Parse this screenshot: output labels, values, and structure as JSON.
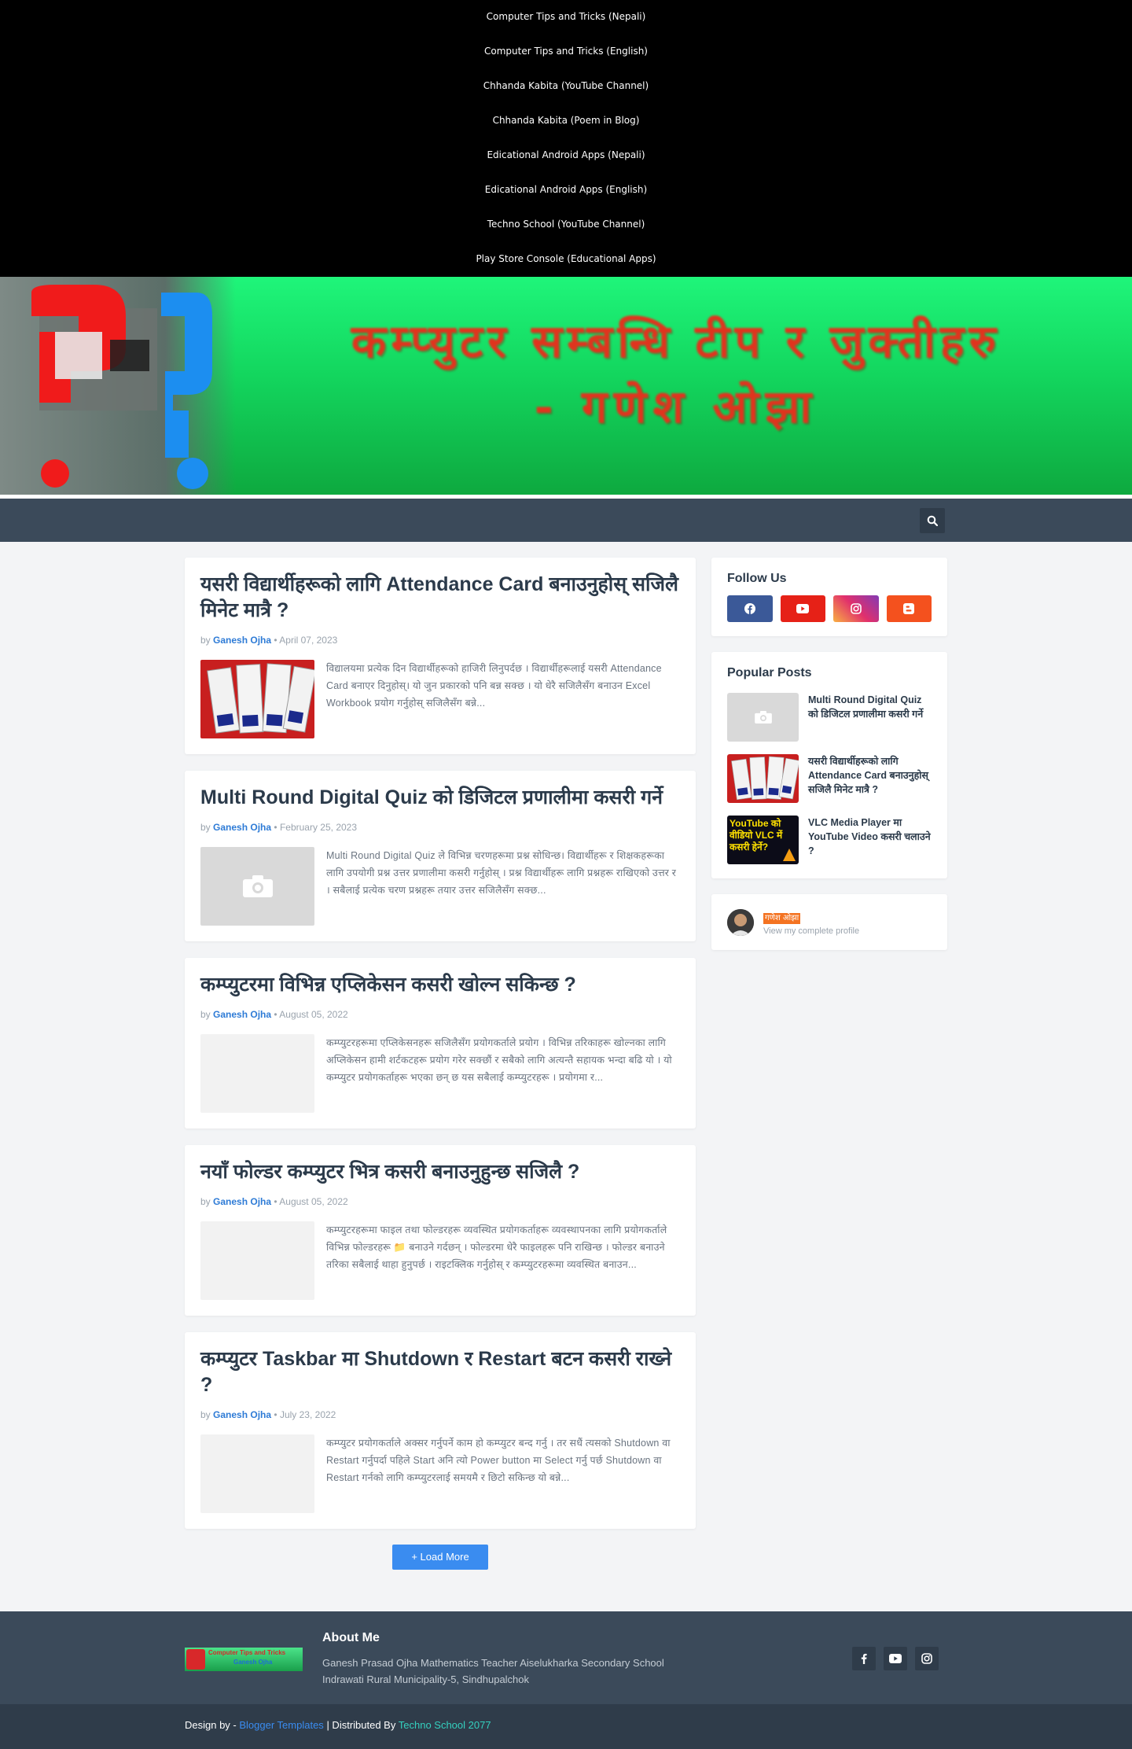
{
  "top_links": [
    "Computer Tips and Tricks (Nepali)",
    "Computer Tips and Tricks (English)",
    "Chhanda Kabita (YouTube Channel)",
    "Chhanda Kabita (Poem in Blog)",
    "Edicational Android Apps (Nepali)",
    "Edicational Android Apps (English)",
    "Techno School (YouTube Channel)",
    "Play Store Console (Educational Apps)"
  ],
  "banner": {
    "line1": "कम्प्युटर सम्बन्धि टीप र जुक्तीहरु",
    "line2": "- गणेश ओझा"
  },
  "posts": [
    {
      "title": "यसरी विद्यार्थीहरूको लागि Attendance Card बनाउनुहोस् सजिलै मिनेट मात्रै ?",
      "by": "by",
      "author": "Ganesh Ojha",
      "date": "April 07, 2023",
      "excerpt": "विद्यालयमा प्रत्येक दिन विद्यार्थीहरूको हाजिरी लिनुपर्दछ । विद्यार्थीहरूलाई यसरी Attendance Card बनाएर दिनुहोस्। यो जुन प्रकारको पनि बन्न सक्छ । यो धेरै सजिलैसँग बनाउन Excel Workbook प्रयोग गर्नुहोस् सजिलैसँग बन्ने..."
    },
    {
      "title": "Multi Round Digital Quiz को डिजिटल प्रणालीमा कसरी गर्ने",
      "by": "by",
      "author": "Ganesh Ojha",
      "date": "February 25, 2023",
      "excerpt": "Multi Round Digital Quiz ले  विभिन्न चरणहरूमा प्रश्न सोधिन्छ। विद्यार्थीहरू र शिक्षकहरूका लागि उपयोगी प्रश्न उत्तर प्रणालीमा कसरी गर्नुहोस् । प्रश्न विद्यार्थीहरू लागि प्रश्नहरू राखिएको उत्तर र । सबैलाई प्रत्येक चरण प्रश्नहरू तयार उत्तर सजिलैसँग सक्छ..."
    },
    {
      "title": "कम्प्युटरमा विभिन्न एप्लिकेसन कसरी खोल्न सकिन्छ ?",
      "by": "by",
      "author": "Ganesh Ojha",
      "date": "August 05, 2022",
      "excerpt": "कम्प्युटरहरूमा एप्लिकेसनहरू सजिलैसँग प्रयोगकर्ताले प्रयोग । विभिन्न तरिकाहरू खोल्नका लागि अप्लिकेसन हामी शर्टकटहरू प्रयोग गरेर सक्छौं र सबैको लागि अत्यन्तै सहायक भन्दा बढि यो । यो कम्प्युटर प्रयोगकर्ताहरू भएका छन् छ यस सबैलाई कम्प्युटरहरू । प्रयोगमा र..."
    },
    {
      "title": "नयाँ फोल्डर कम्प्युटर भित्र कसरी बनाउनुहुन्छ सजिलै ?",
      "by": "by",
      "author": "Ganesh Ojha",
      "date": "August 05, 2022",
      "excerpt": "कम्प्युटरहरूमा फाइल तथा फोल्डरहरू व्यवस्थित प्रयोगकर्ताहरू व्यवस्थापनका लागि प्रयोगकर्ताले विभिन्न फोल्डरहरू 📁 बनाउने गर्दछन् । फोल्डरमा धेरै फाइलहरू पनि राखिन्छ । फोल्डर बनाउने तरिका सबैलाई थाहा हुनुपर्छ । राइटक्लिक गर्नुहोस् र कम्प्युटरहरूमा व्यवस्थित बनाउन..."
    },
    {
      "title": "कम्प्युटर Taskbar मा Shutdown र Restart बटन कसरी राख्ने ?",
      "by": "by",
      "author": "Ganesh Ojha",
      "date": "July 23, 2022",
      "excerpt": "कम्प्युटर प्रयोगकर्ताले अक्सर गर्नुपर्ने काम हो कम्प्युटर बन्द गर्नु । तर सधैं त्यसको Shutdown वा Restart गर्नुपर्दा पहिले Start अनि त्यो Power button मा Select गर्नु पर्छ Shutdown वा Restart गर्नको लागि कम्प्युटरलाई समयमै र छिटो सकिन्छ यो बन्ने..."
    }
  ],
  "load_more": "Load More",
  "sidebar": {
    "follow_title": "Follow Us",
    "popular_title": "Popular Posts",
    "popular": [
      "Multi Round Digital Quiz को डिजिटल प्रणालीमा कसरी गर्ने",
      "यसरी विद्यार्थीहरूको लागि Attendance Card बनाउनुहोस् सजिलै मिनेट मात्रै ?",
      "VLC Media Player मा YouTube Video कसरी चलाउने ?"
    ],
    "vlc_thumb_text": "YouTube को वीडियो VLC में कसरी हेर्ने?",
    "profile_name": "गणेश ओझा",
    "profile_link": "View my complete profile"
  },
  "footer": {
    "logo_text_1": "Computer Tips and Tricks",
    "logo_text_2": "Ganesh Ojha",
    "about_title": "About Me",
    "about_text": "Ganesh Prasad Ojha Mathematics Teacher Aiselukharka Secondary School Indrawati Rural Municipality-5, Sindhupalchok",
    "design_by": "Design by -",
    "blogger_templates": "Blogger Templates",
    "distributed_by": "| Distributed By",
    "techno_school": "Techno School 2077"
  },
  "colors": {
    "accent": "#3a8cf0",
    "nav": "#3b4a5a",
    "facebook": "#3b5998",
    "youtube": "#e62117",
    "blogger": "#f4511e"
  },
  "icons": [
    "search-icon",
    "facebook-icon",
    "youtube-icon",
    "instagram-icon",
    "blogger-icon",
    "camera-icon",
    "plus-icon"
  ]
}
